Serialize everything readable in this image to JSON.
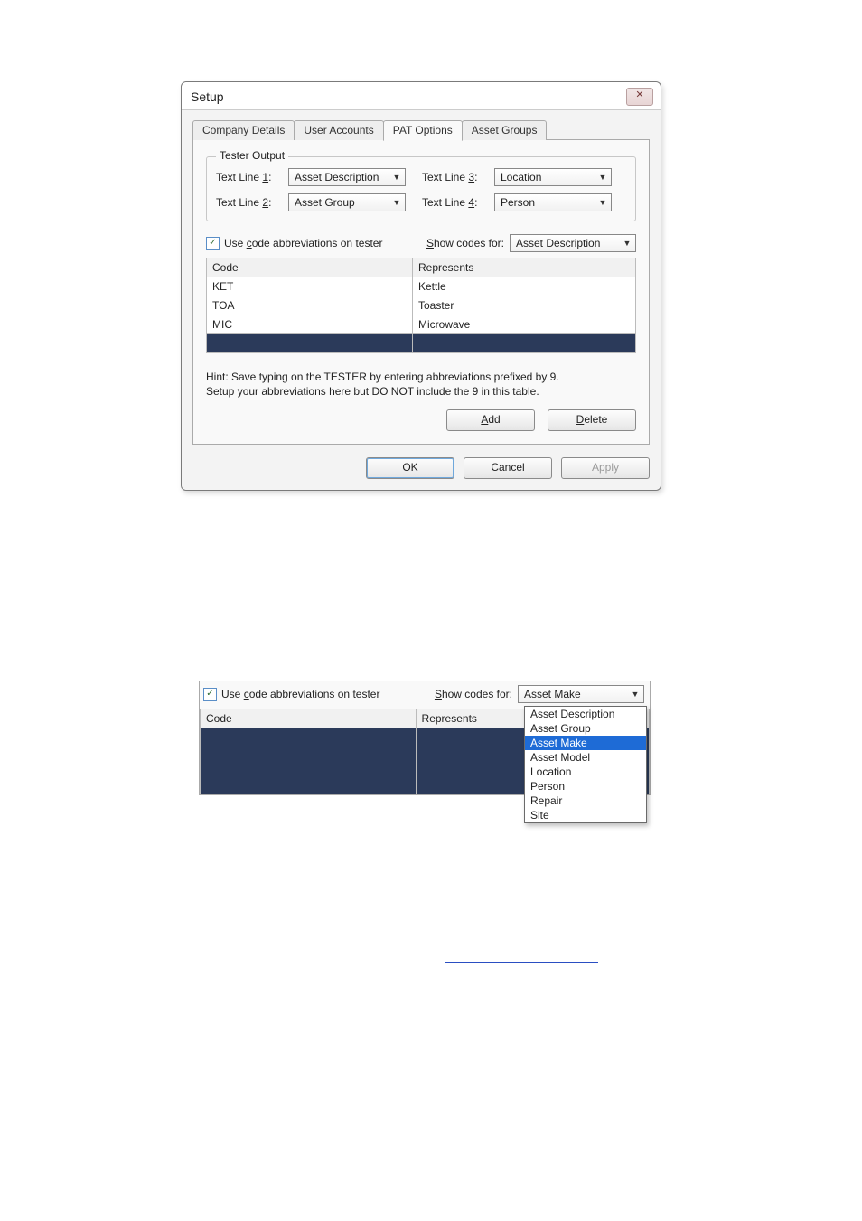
{
  "dialog": {
    "title": "Setup",
    "tabs": [
      "Company Details",
      "User Accounts",
      "PAT Options",
      "Asset Groups"
    ],
    "active_tab_index": 2,
    "tester_output_legend": "Tester Output",
    "text_line_labels": {
      "l1": "Text Line 1:",
      "l1_u": "1",
      "l2": "Text Line 2:",
      "l2_u": "2",
      "l3": "Text Line 3:",
      "l3_u": "3",
      "l4": "Text Line 4:",
      "l4_u": "4"
    },
    "text_line_values": {
      "l1": "Asset Description",
      "l2": "Asset Group",
      "l3": "Location",
      "l4": "Person"
    },
    "use_codes_checked": true,
    "use_codes_label": "Use code abbreviations on tester",
    "use_codes_u": "c",
    "show_codes_label": "Show codes for:",
    "show_codes_u": "S",
    "show_codes_value": "Asset Description",
    "table": {
      "headers": [
        "Code",
        "Represents"
      ],
      "rows": [
        {
          "code": "KET",
          "rep": "Kettle"
        },
        {
          "code": "TOA",
          "rep": "Toaster"
        },
        {
          "code": "MIC",
          "rep": "Microwave"
        }
      ]
    },
    "hint_line1": "Hint: Save typing on the TESTER by entering abbreviations prefixed by 9.",
    "hint_line2": "Setup your abbreviations here but DO NOT include the 9 in this table.",
    "buttons": {
      "add": "Add",
      "add_u": "A",
      "delete": "Delete",
      "delete_u": "D",
      "ok": "OK",
      "cancel": "Cancel",
      "apply": "Apply"
    }
  },
  "fragment2": {
    "use_codes_label": "Use code abbreviations on tester",
    "use_codes_u": "c",
    "use_codes_checked": true,
    "show_codes_label": "Show codes for:",
    "show_codes_u": "S",
    "show_codes_value": "Asset Make",
    "table_headers": [
      "Code",
      "Represents"
    ],
    "dropdown_options": [
      "Asset Description",
      "Asset Group",
      "Asset Make",
      "Asset Model",
      "Location",
      "Person",
      "Repair",
      "Site"
    ],
    "dropdown_selected_index": 2
  }
}
